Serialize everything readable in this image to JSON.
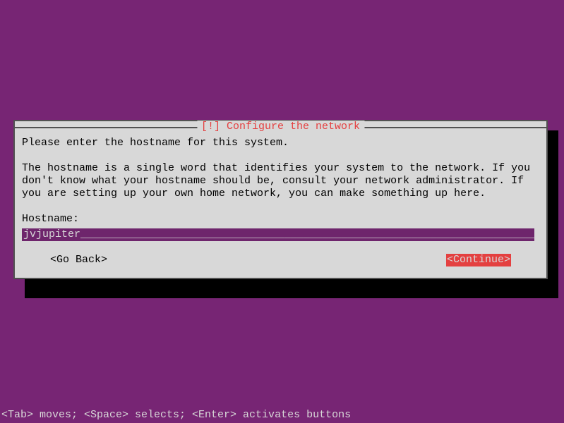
{
  "dialog": {
    "title_prefix": "[!]",
    "title": "Configure the network",
    "instruction": "Please enter the hostname for this system.",
    "description": "The hostname is a single word that identifies your system to the network. If you don't know what your hostname should be, consult your network administrator. If you are setting up your own home network, you can make something up here.",
    "field_label": "Hostname:",
    "input_value": "jvjupiter",
    "go_back_label": "<Go Back>",
    "continue_label": "<Continue>"
  },
  "footer": {
    "help_text": "<Tab> moves; <Space> selects; <Enter> activates buttons"
  }
}
